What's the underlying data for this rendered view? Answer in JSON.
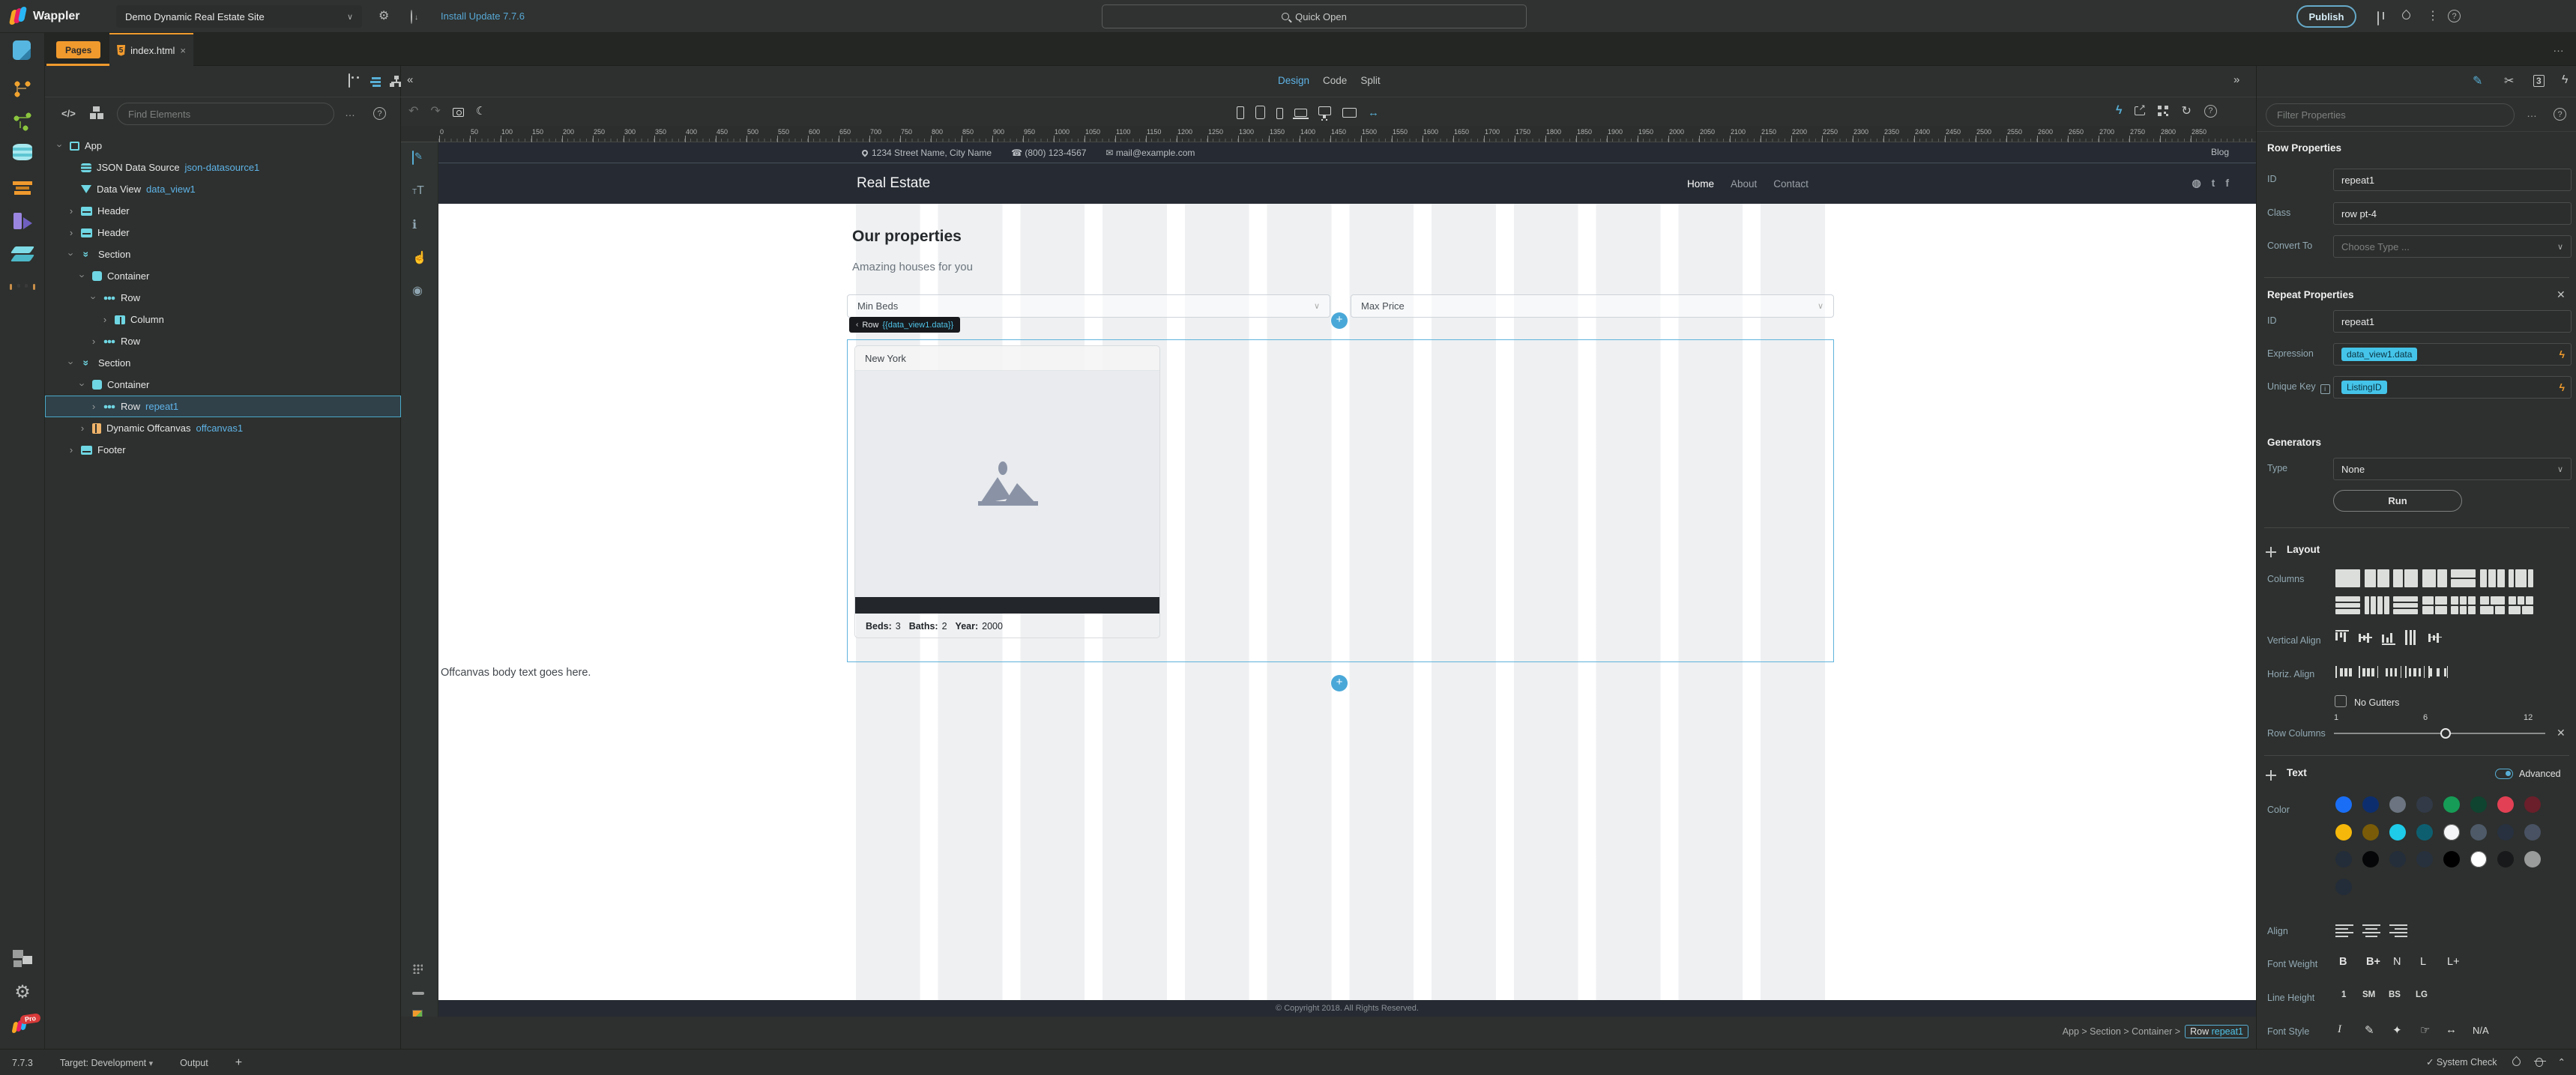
{
  "topbar": {
    "app_name": "Wappler",
    "project_name": "Demo Dynamic Real Estate Site",
    "update_link": "Install Update 7.7.6",
    "quick_open": "Quick Open",
    "publish": "Publish"
  },
  "tabs": {
    "pages": "Pages",
    "file": "index.html",
    "close": "×"
  },
  "sidebar": {
    "top_icons": [
      "pages-icon",
      "git-icon",
      "api-icon",
      "database-icon",
      "styles-icon",
      "server-icon",
      "layers-icon",
      "ai-icon"
    ],
    "bottom_icons": [
      "extensions-icon",
      "settings-icon",
      "wappler-pro-icon"
    ],
    "pro_badge": "Pro"
  },
  "tree": {
    "find_placeholder": "Find Elements",
    "items": [
      {
        "label": "App",
        "icon": "app",
        "depth": 0,
        "exp": "open"
      },
      {
        "label": "JSON Data Source",
        "sub": "json-datasource1",
        "icon": "database",
        "depth": 1,
        "exp": "none"
      },
      {
        "label": "Data View",
        "sub": "data_view1",
        "icon": "dataview",
        "depth": 1,
        "exp": "none"
      },
      {
        "label": "Header",
        "icon": "header",
        "depth": 1,
        "exp": "closed"
      },
      {
        "label": "Header",
        "icon": "header",
        "depth": 1,
        "exp": "closed"
      },
      {
        "label": "Section",
        "icon": "section",
        "depth": 1,
        "exp": "open"
      },
      {
        "label": "Container",
        "icon": "container",
        "depth": 2,
        "exp": "open"
      },
      {
        "label": "Row",
        "icon": "row",
        "depth": 3,
        "exp": "open"
      },
      {
        "label": "Column",
        "icon": "column",
        "depth": 4,
        "exp": "closed"
      },
      {
        "label": "Row",
        "icon": "row",
        "depth": 3,
        "exp": "closed"
      },
      {
        "label": "Section",
        "icon": "section",
        "depth": 1,
        "exp": "open"
      },
      {
        "label": "Container",
        "icon": "container",
        "depth": 2,
        "exp": "open"
      },
      {
        "label": "Row",
        "sub": "repeat1",
        "icon": "row",
        "depth": 3,
        "exp": "closed",
        "selected": true
      },
      {
        "label": "Dynamic Offcanvas",
        "sub": "offcanvas1",
        "icon": "offcanvas",
        "depth": 2,
        "exp": "closed"
      },
      {
        "label": "Footer",
        "icon": "footer",
        "depth": 1,
        "exp": "closed"
      }
    ]
  },
  "canvas": {
    "modes": [
      "Design",
      "Code",
      "Split"
    ],
    "active_mode": "Design",
    "devices": [
      "phone",
      "tablet",
      "phone-landscape",
      "laptop",
      "desktop",
      "monitor",
      "auto-size"
    ],
    "ruler": {
      "unit": 50,
      "px": 41,
      "count": 58
    }
  },
  "page": {
    "contact": {
      "address": "1234 Street Name, City Name",
      "phone": "(800) 123-4567",
      "email": "mail@example.com",
      "blog": "Blog"
    },
    "nav": {
      "brand": "Real Estate",
      "items": [
        "Home",
        "About",
        "Contact"
      ]
    },
    "heading": "Our properties",
    "subheading": "Amazing houses for you",
    "filters": {
      "min_beds": "Min Beds",
      "max_price": "Max Price"
    },
    "badge": {
      "prefix": "Row",
      "expr": "{{data_view1.data}}"
    },
    "card": {
      "title": "New York",
      "beds_label": "Beds:",
      "beds": "3",
      "baths_label": "Baths:",
      "baths": "2",
      "year_label": "Year:",
      "year": "2000"
    },
    "offcanvas_text": "Offcanvas body text goes here.",
    "footer": "© Copyright 2018. All Rights Reserved."
  },
  "props": {
    "filter_placeholder": "Filter Properties",
    "row_properties": {
      "title": "Row Properties",
      "id_label": "ID",
      "id": "repeat1",
      "class_label": "Class",
      "class": "row pt-4",
      "convert_label": "Convert To",
      "convert_placeholder": "Choose Type ..."
    },
    "repeat_properties": {
      "title": "Repeat Properties",
      "id_label": "ID",
      "id": "repeat1",
      "expression_label": "Expression",
      "expression": "data_view1.data",
      "unique_key_label": "Unique Key",
      "unique_key": "ListingID"
    },
    "generators": {
      "title": "Generators",
      "type_label": "Type",
      "type": "None",
      "run": "Run"
    },
    "layout": {
      "title": "Layout",
      "columns_label": "Columns",
      "columns_patterns": [
        [
          [
            12
          ]
        ],
        [
          [
            6,
            6
          ]
        ],
        [
          [
            5,
            7
          ]
        ],
        [
          [
            7,
            5
          ]
        ],
        [
          [
            12
          ],
          [
            12
          ]
        ],
        [
          [
            4,
            4,
            4
          ]
        ],
        [
          [
            3,
            6,
            3
          ]
        ],
        [
          [
            12
          ],
          [
            12
          ],
          [
            12
          ]
        ],
        [
          [
            3,
            3,
            3,
            3
          ]
        ],
        [
          [
            12
          ],
          [
            12
          ],
          [
            12
          ]
        ],
        [
          [
            6,
            6
          ],
          [
            6,
            6
          ]
        ],
        [
          [
            4,
            4,
            4
          ],
          [
            4,
            4,
            4
          ]
        ],
        [
          [
            5,
            7
          ],
          [
            7,
            5
          ]
        ],
        [
          [
            4,
            4,
            4
          ],
          [
            6,
            6
          ]
        ]
      ],
      "valign_label": "Vertical Align",
      "valign_options": [
        "top",
        "middle",
        "bottom",
        "stretch",
        "baseline"
      ],
      "halign_label": "Horiz. Align",
      "halign_options": [
        "start",
        "center",
        "end",
        "between",
        "around"
      ],
      "no_gutters": "No Gutters",
      "row_columns_label": "Row Columns",
      "slider": {
        "min": "1",
        "mid": "6",
        "max": "12"
      }
    },
    "text": {
      "title": "Text",
      "advanced": "Advanced",
      "color_label": "Color",
      "colors": [
        "#1a6ef5",
        "#0d2e6e",
        "#6b7480",
        "#323a47",
        "#169c56",
        "#0f4430",
        "#e24054",
        "#6a1f2a",
        "#f5b70a",
        "#7a5c08",
        "#1ecbe8",
        "#0d5f70",
        "#f5f6f7",
        "#4e5a68",
        "#27313f",
        "#495263",
        "#232c39",
        "#050607",
        "#242d3a",
        "#27303d",
        "#000000",
        "#ffffff",
        "#17191a",
        "#9a9c9b",
        "#232c39"
      ],
      "align_label": "Align",
      "align_options": [
        "left",
        "center",
        "right"
      ],
      "weight_label": "Font Weight",
      "weights": [
        "B",
        "B+",
        "N",
        "L",
        "L+"
      ],
      "line_height_label": "Line Height",
      "line_heights": [
        "1",
        "SM",
        "BS",
        "LG"
      ],
      "font_style_label": "Font Style",
      "font_styles": [
        "italic",
        "marker",
        "rocket",
        "hand",
        "text-width"
      ],
      "na": "N/A"
    }
  },
  "breadcrumb": {
    "path": [
      "App",
      "Section",
      "Container"
    ],
    "current_tag": "Row",
    "current_id": "repeat1"
  },
  "statusbar": {
    "version": "7.7.3",
    "target_label": "Target: Development",
    "output": "Output",
    "system_check": "System Check"
  }
}
